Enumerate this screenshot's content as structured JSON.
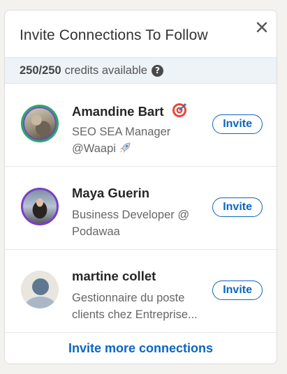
{
  "dialog": {
    "title": "Invite Connections To Follow",
    "close_icon": "close-icon"
  },
  "credits": {
    "count": "250/250",
    "label": "credits available",
    "help_icon": "question-circle-icon",
    "help_glyph": "?"
  },
  "connections": [
    {
      "name": "Amandine Bart",
      "name_emoji": "target-icon",
      "headline_line1": "SEO SEA Manager",
      "headline_line2": "@Waapi",
      "headline_emoji": "rocket-icon",
      "invite_label": "Invite"
    },
    {
      "name": "Maya Guerin",
      "headline_line1": "Business Developer @",
      "headline_line2": "Podawaa",
      "invite_label": "Invite"
    },
    {
      "name": "martine collet",
      "headline_line1": "Gestionnaire du poste",
      "headline_line2": "clients chez Entreprise...",
      "invite_label": "Invite"
    }
  ],
  "footer": {
    "link_label": "Invite more connections"
  },
  "colors": {
    "accent": "#0a66c2",
    "credits_bg": "#eef3f8"
  }
}
